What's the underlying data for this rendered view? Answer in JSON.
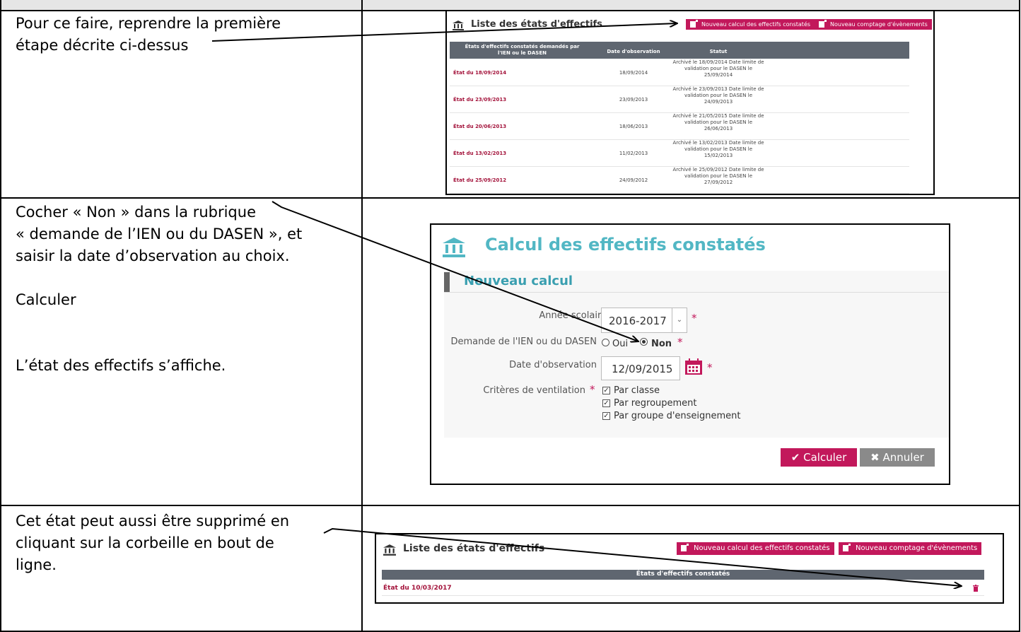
{
  "rows": [
    {
      "text": [
        "Pour ce faire, reprendre la première",
        "étape décrite ci-dessus"
      ]
    },
    {
      "text": [
        "Cocher « Non » dans la rubrique",
        "« demande de l’IEN ou du DASEN », et",
        "saisir la date d’observation au choix.",
        "",
        "Calculer",
        "",
        "",
        "L’état des effectifs s’affiche."
      ]
    },
    {
      "text": [
        "Cet état peut aussi être supprimé en",
        "cliquant sur la corbeille en bout de",
        "ligne."
      ]
    }
  ],
  "list1": {
    "title": "Liste des états d'effectifs",
    "btn_new_calc": "Nouveau calcul des effectifs constatés",
    "btn_new_count": "Nouveau comptage d'évènements",
    "col1": "États d'effectifs constatés demandés par l'IEN ou le DASEN",
    "col2": "Date d'observation",
    "col3": "Statut",
    "items": [
      {
        "name": "État du 18/09/2014",
        "date": "18/09/2014",
        "status": "Archivé le 18/09/2014 Date limite de validation pour le DASEN le 25/09/2014"
      },
      {
        "name": "État du 23/09/2013",
        "date": "23/09/2013",
        "status": "Archivé le 23/09/2013 Date limite de validation pour le DASEN le 24/09/2013"
      },
      {
        "name": "État du 20/06/2013",
        "date": "18/06/2013",
        "status": "Archivé le 21/05/2015 Date limite de validation pour le DASEN le 26/06/2013"
      },
      {
        "name": "État du 13/02/2013",
        "date": "11/02/2013",
        "status": "Archivé le 13/02/2013 Date limite de validation pour le DASEN le 15/02/2013"
      },
      {
        "name": "État du 25/09/2012",
        "date": "24/09/2012",
        "status": "Archivé le 25/09/2012 Date limite de validation pour le DASEN le 27/09/2012"
      }
    ]
  },
  "calc": {
    "title": "Calcul des effectifs constatés",
    "section": "Nouveau calcul",
    "annee_label": "Année scolaire",
    "annee_value": "2016-2017",
    "demande_label": "Demande de l'IEN ou du DASEN",
    "opt_oui": "Oui",
    "opt_non": "Non",
    "demande_selected": "Non",
    "date_label": "Date d'observation",
    "date_value": "12/09/2015",
    "criteres_label": "Critères de ventilation",
    "criteres": [
      "Par classe",
      "Par regroupement",
      "Par groupe d'enseignement"
    ],
    "btn_calculer": "Calculer",
    "btn_annuler": "Annuler",
    "required_mark": "*"
  },
  "list2": {
    "title": "Liste des états d'effectifs",
    "btn_new_calc": "Nouveau calcul des effectifs constatés",
    "btn_new_count": "Nouveau comptage d'évènements",
    "col": "États d'effectifs constatés",
    "item": "État du 10/03/2017"
  },
  "colors": {
    "accent": "#c2185b",
    "teal": "#52b7c4",
    "header": "#5f6670"
  }
}
